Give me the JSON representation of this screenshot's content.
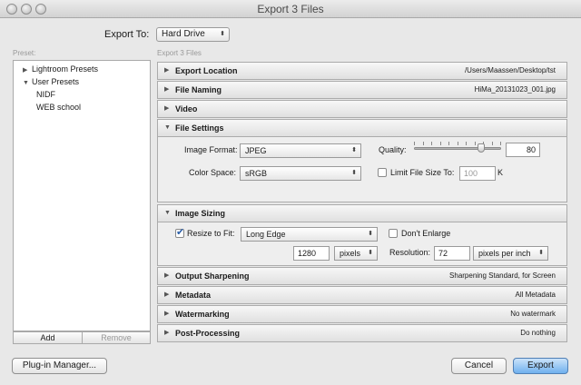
{
  "window": {
    "title": "Export 3 Files"
  },
  "export_to": {
    "label": "Export To:",
    "value": "Hard Drive"
  },
  "preset": {
    "label": "Preset:",
    "items": [
      {
        "label": "Lightroom Presets",
        "expanded": false
      },
      {
        "label": "User Presets",
        "expanded": true
      },
      {
        "label": "NIDF"
      },
      {
        "label": "WEB school"
      }
    ],
    "add_label": "Add",
    "remove_label": "Remove"
  },
  "main": {
    "header": "Export 3 Files"
  },
  "sections": {
    "export_location": {
      "title": "Export Location",
      "summary": "/Users/Maassen/Desktop/tst"
    },
    "file_naming": {
      "title": "File Naming",
      "summary": "HiMa_20131023_001.jpg"
    },
    "video": {
      "title": "Video"
    },
    "file_settings": {
      "title": "File Settings",
      "image_format_label": "Image Format:",
      "image_format": "JPEG",
      "quality_label": "Quality:",
      "quality": "80",
      "quality_fraction": 0.8,
      "color_space_label": "Color Space:",
      "color_space": "sRGB",
      "limit_label": "Limit File Size To:",
      "limit_value": "100",
      "limit_unit": "K"
    },
    "image_sizing": {
      "title": "Image Sizing",
      "resize_label": "Resize to Fit:",
      "resize_value": "Long Edge",
      "dont_enlarge_label": "Don't Enlarge",
      "size_value": "1280",
      "size_unit": "pixels",
      "resolution_label": "Resolution:",
      "resolution_value": "72",
      "resolution_unit": "pixels per inch"
    },
    "output_sharpening": {
      "title": "Output Sharpening",
      "summary": "Sharpening Standard, for Screen"
    },
    "metadata": {
      "title": "Metadata",
      "summary": "All Metadata"
    },
    "watermarking": {
      "title": "Watermarking",
      "summary": "No watermark"
    },
    "post_processing": {
      "title": "Post-Processing",
      "summary": "Do nothing"
    }
  },
  "footer": {
    "plugin_manager": "Plug-in Manager...",
    "cancel": "Cancel",
    "export": "Export"
  },
  "icons": {
    "collapsed": "▶",
    "expanded": "▼",
    "popup_arrows": "⬍",
    "check": "✔"
  }
}
